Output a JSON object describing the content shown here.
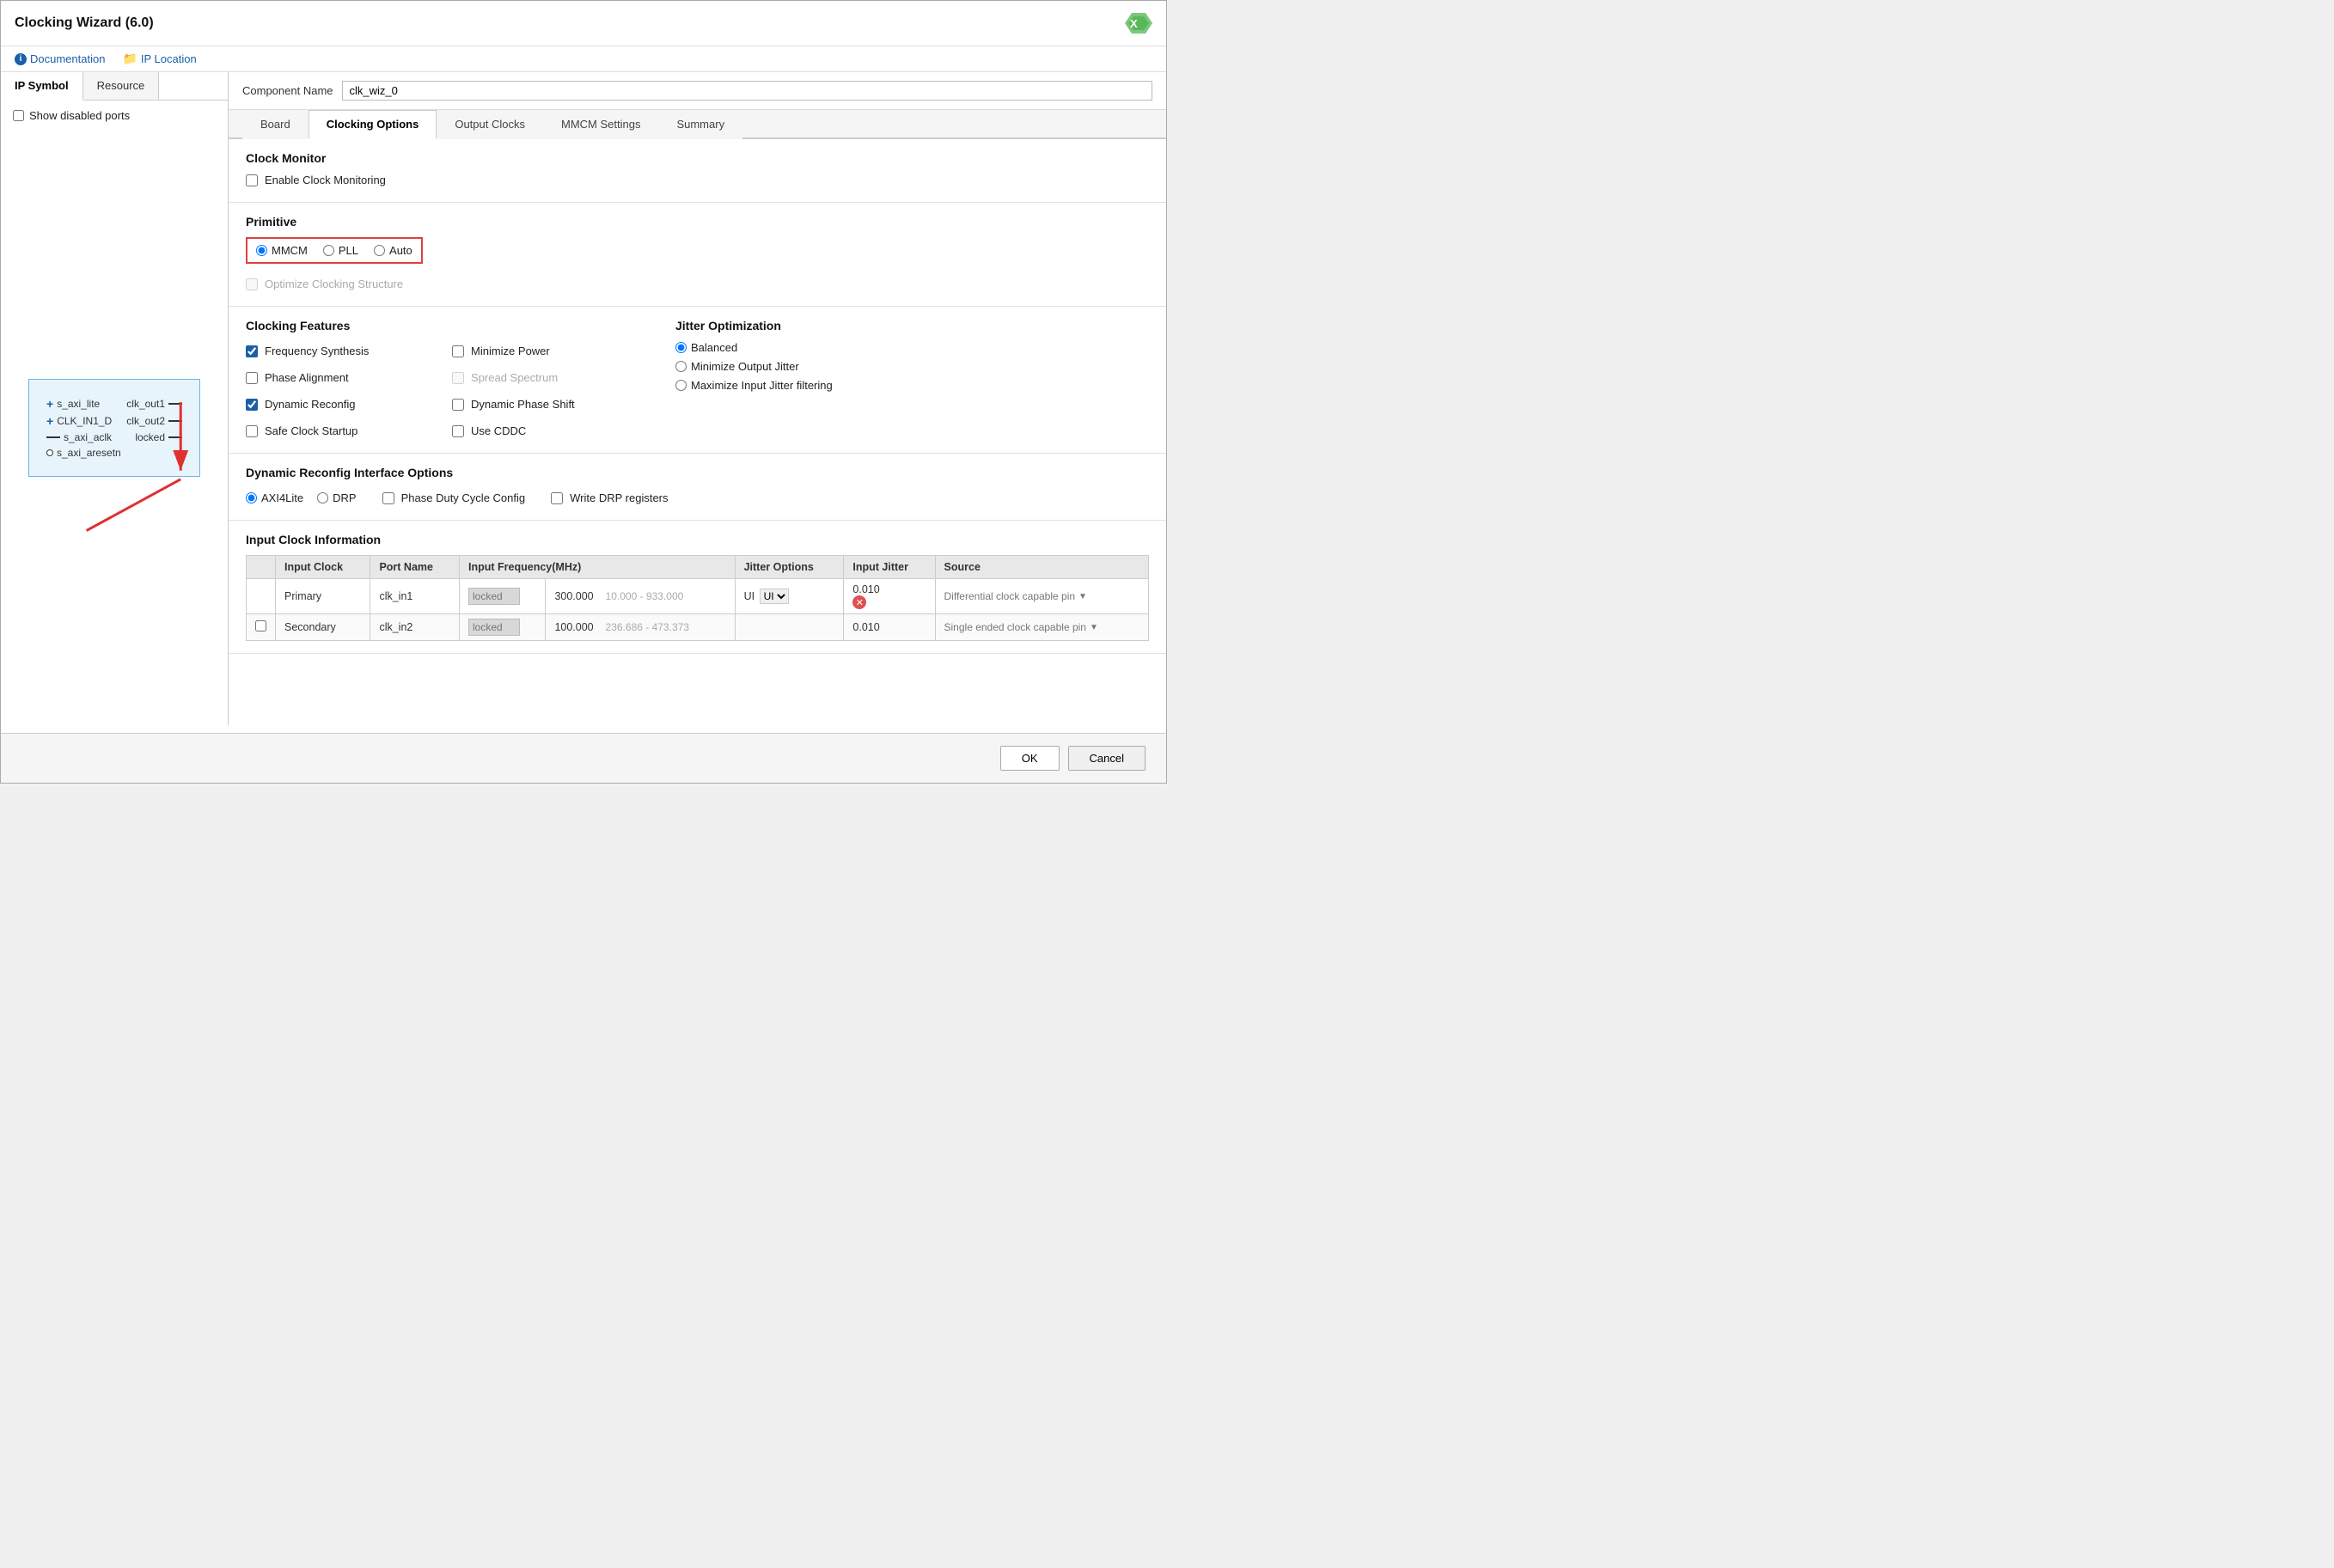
{
  "window": {
    "title": "Clocking Wizard (6.0)"
  },
  "toolbar": {
    "documentation_label": "Documentation",
    "ip_location_label": "IP Location"
  },
  "sidebar": {
    "tab1": "IP Symbol",
    "tab2": "Resource",
    "show_disabled_ports": "Show disabled ports",
    "ports_left": [
      {
        "type": "plus",
        "name": "s_axi_lite"
      },
      {
        "type": "plus",
        "name": "CLK_IN1_D"
      },
      {
        "type": "dash",
        "name": "s_axi_aclk"
      },
      {
        "type": "circle",
        "name": "s_axi_aresetn"
      }
    ],
    "ports_right": [
      {
        "name": "clk_out1"
      },
      {
        "name": "clk_out2"
      },
      {
        "name": "locked"
      }
    ]
  },
  "component_name": {
    "label": "Component Name",
    "value": "clk_wiz_0"
  },
  "tabs": [
    {
      "label": "Board",
      "active": false
    },
    {
      "label": "Clocking Options",
      "active": true
    },
    {
      "label": "Output Clocks",
      "active": false
    },
    {
      "label": "MMCM Settings",
      "active": false
    },
    {
      "label": "Summary",
      "active": false
    }
  ],
  "clock_monitor": {
    "title": "Clock Monitor",
    "enable_label": "Enable Clock Monitoring",
    "enabled": false
  },
  "primitive": {
    "title": "Primitive",
    "options": [
      "MMCM",
      "PLL",
      "Auto"
    ],
    "selected": "MMCM",
    "optimize_label": "Optimize Clocking Structure",
    "optimize_enabled": false
  },
  "clocking_features": {
    "title": "Clocking Features",
    "features": [
      {
        "label": "Frequency Synthesis",
        "checked": true,
        "disabled": false
      },
      {
        "label": "Phase Alignment",
        "checked": false,
        "disabled": false
      },
      {
        "label": "Dynamic Reconfig",
        "checked": true,
        "disabled": false
      },
      {
        "label": "Safe Clock Startup",
        "checked": false,
        "disabled": false
      }
    ],
    "features_right": [
      {
        "label": "Minimize Power",
        "checked": false,
        "disabled": false
      },
      {
        "label": "Spread Spectrum",
        "checked": false,
        "disabled": true
      },
      {
        "label": "Dynamic Phase Shift",
        "checked": false,
        "disabled": false
      },
      {
        "label": "Use CDDC",
        "checked": false,
        "disabled": false
      }
    ]
  },
  "jitter_optimization": {
    "title": "Jitter Optimization",
    "options": [
      {
        "label": "Balanced",
        "selected": true
      },
      {
        "label": "Minimize Output Jitter",
        "selected": false
      },
      {
        "label": "Maximize Input Jitter filtering",
        "selected": false
      }
    ]
  },
  "dynamic_reconfig": {
    "title": "Dynamic Reconfig Interface Options",
    "interface_options": [
      "AXI4Lite",
      "DRP"
    ],
    "selected": "AXI4Lite",
    "extra_options": [
      {
        "label": "Phase Duty Cycle Config",
        "checked": false
      },
      {
        "label": "Write DRP registers",
        "checked": false
      }
    ]
  },
  "input_clock": {
    "title": "Input Clock Information",
    "headers": [
      "",
      "Input Clock",
      "Port Name",
      "Input Frequency(MHz)",
      "",
      "Jitter Options",
      "Input Jitter",
      "Source"
    ],
    "rows": [
      {
        "checkbox": false,
        "show_checkbox": false,
        "input_clock": "Primary",
        "port_name": "clk_in1",
        "freq_placeholder": "locked",
        "freq_value": "300.000",
        "freq_range": "10.000 - 933.000",
        "jitter_options": "UI",
        "jitter_dropdown": true,
        "input_jitter": "0.010",
        "close_btn": true,
        "source": "Differential clock capable pin",
        "source_dropdown": true
      },
      {
        "checkbox": false,
        "show_checkbox": true,
        "input_clock": "Secondary",
        "port_name": "clk_in2",
        "freq_placeholder": "locked",
        "freq_value": "100.000",
        "freq_range": "236.686 - 473.373",
        "jitter_options": "",
        "jitter_dropdown": false,
        "input_jitter": "0.010",
        "close_btn": false,
        "source": "Single ended clock capable pin",
        "source_dropdown": true
      }
    ]
  },
  "bottom_buttons": {
    "ok": "OK",
    "cancel": "Cancel"
  }
}
